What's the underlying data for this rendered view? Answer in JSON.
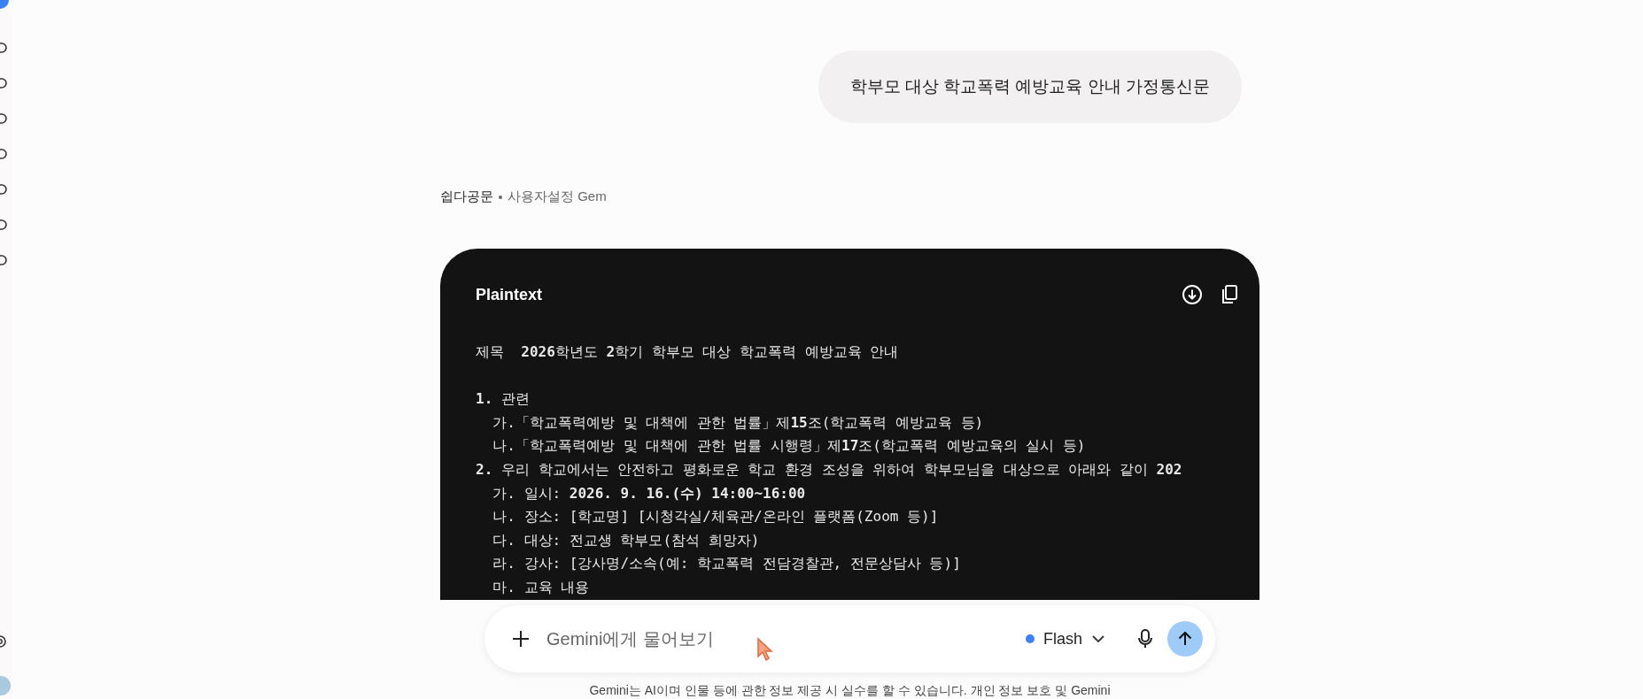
{
  "user_message": {
    "text": "학부모 대상 학교폭력 예방교육 안내 가정통신문"
  },
  "response_meta": {
    "gem_name": "쉽다공문",
    "gem_type": "사용자설정 Gem"
  },
  "code_block": {
    "language": "Plaintext",
    "paragraphs": [
      [
        "제목  **2026**학년도 **2**학기 학부모 대상 학교폭력 예방교육 안내"
      ],
      [
        "**1.** 관련",
        "  가.「학교폭력예방 및 대책에 관한 법률」제**15**조(학교폭력 예방교육 등)",
        "  나.「학교폭력예방 및 대책에 관한 법률 시행령」제**17**조(학교폭력 예방교육의 실시 등)",
        "**2.** 우리 학교에서는 안전하고 평화로운 학교 환경 조성을 위하여 학부모님을 대상으로 아래와 같이 **202**",
        "  가. 일시: **2026. 9. 16.(수) 14:00~16:00**",
        "  나. 장소: [학교명] [시청각실/체육관/온라인 플랫폼(Zoom 등)]",
        "  다. 대상: 전교생 학부모(참석 희망자)",
        "  라. 강사: [강사명/소속(예: 학교폭력 전담경찰관, 전문상담사 등)]",
        "  마. 교육 내용"
      ]
    ]
  },
  "input_bar": {
    "placeholder": "Gemini에게 물어보기",
    "model": "Flash"
  },
  "disclaimer": "Gemini는 AI이며 인물 등에 관한 정보 제공 시 실수를 할 수 있습니다. 개인 정보 보호 및 Gemini"
}
